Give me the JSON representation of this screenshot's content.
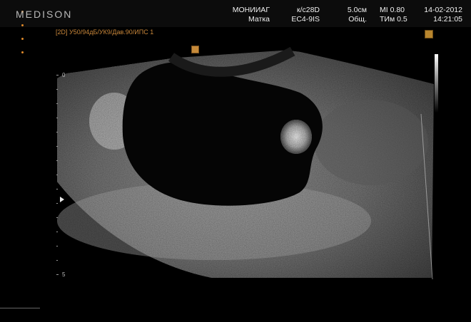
{
  "header": {
    "logo": "MEDISON",
    "institution": "МОНИИАГ",
    "preset": "Матка",
    "app_code": "к/с28D",
    "probe": "EC4-9IS",
    "depth": "5.0см",
    "mode": "Общ.",
    "mi": "MI  0.80",
    "tim": "TИм 0.5",
    "date": "14-02-2012",
    "time": "14:21:05"
  },
  "status_line": "[2D] У50/94дБ/УК9/Дав.90/ИПС 1",
  "depth_scale": {
    "top": "0",
    "bottom": "5"
  },
  "colors": {
    "logo_dots": "#e08a2a",
    "status_text": "#c9873a",
    "marker": "#c68a3a"
  }
}
